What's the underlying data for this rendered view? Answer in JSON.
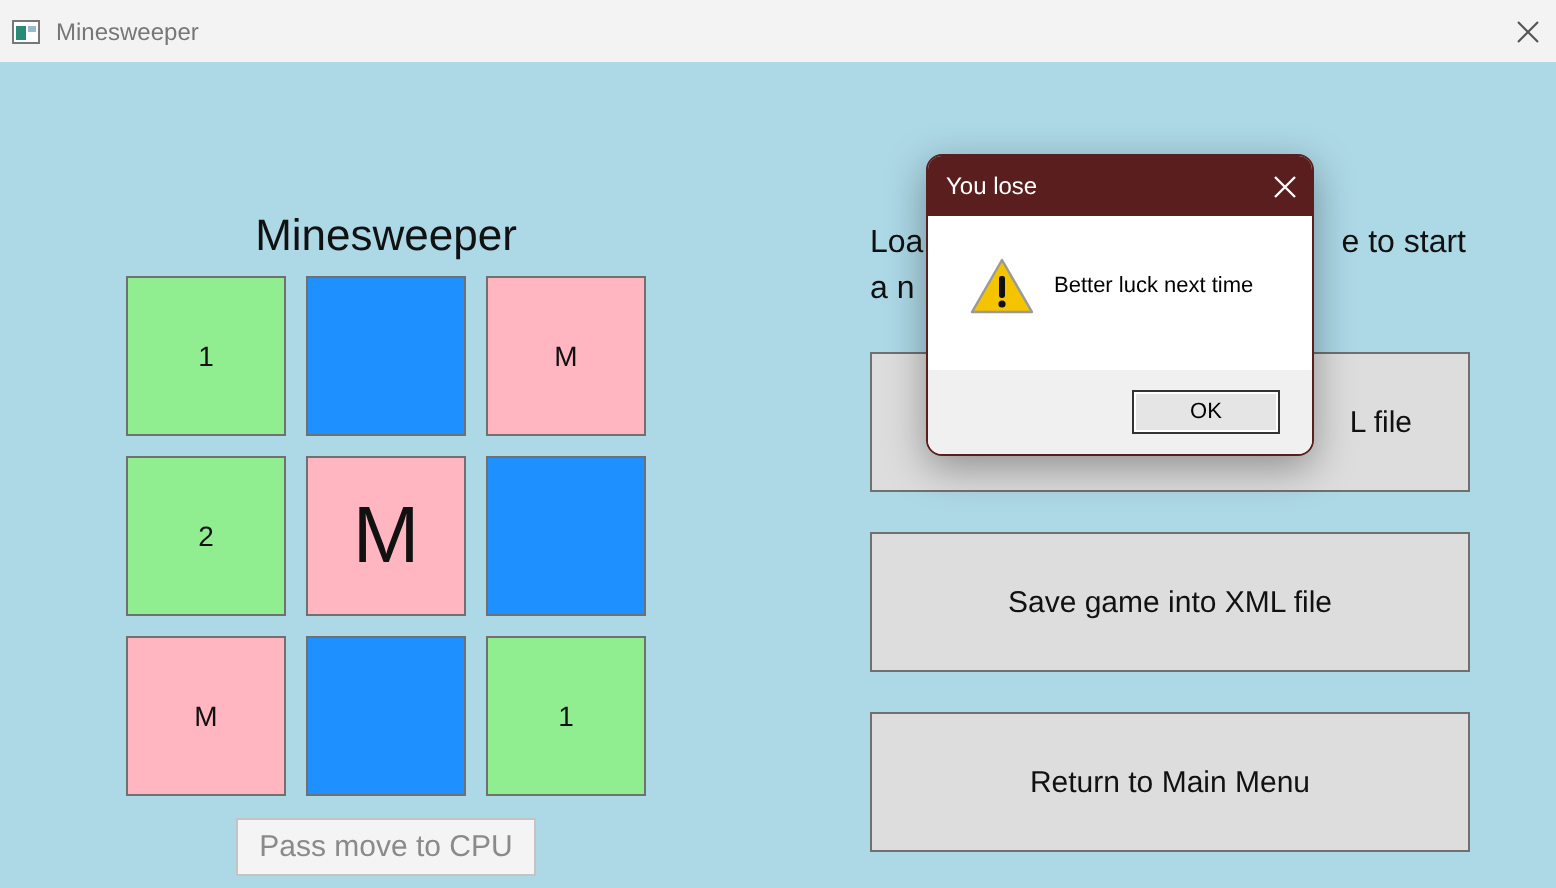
{
  "window": {
    "title": "Minesweeper"
  },
  "board": {
    "title": "Minesweeper",
    "cells": [
      {
        "kind": "number",
        "text": "1"
      },
      {
        "kind": "hidden"
      },
      {
        "kind": "mine",
        "text": "M"
      },
      {
        "kind": "number",
        "text": "2"
      },
      {
        "kind": "mine_hit",
        "text": "M"
      },
      {
        "kind": "hidden"
      },
      {
        "kind": "mine",
        "text": "M"
      },
      {
        "kind": "hidden"
      },
      {
        "kind": "number",
        "text": "1"
      }
    ],
    "pass_button": {
      "label": "Pass move to CPU",
      "disabled": true
    }
  },
  "menu": {
    "prompt_parts": [
      {
        "text": "Loa"
      },
      {
        "text": "e to start"
      },
      {
        "text": "a n"
      }
    ],
    "buttons": [
      {
        "label": "L file"
      },
      {
        "label": "Save game into XML file"
      },
      {
        "label": "Return to Main Menu"
      }
    ]
  },
  "dialog": {
    "title": "You lose",
    "message": "Better luck next time",
    "button": "OK"
  }
}
